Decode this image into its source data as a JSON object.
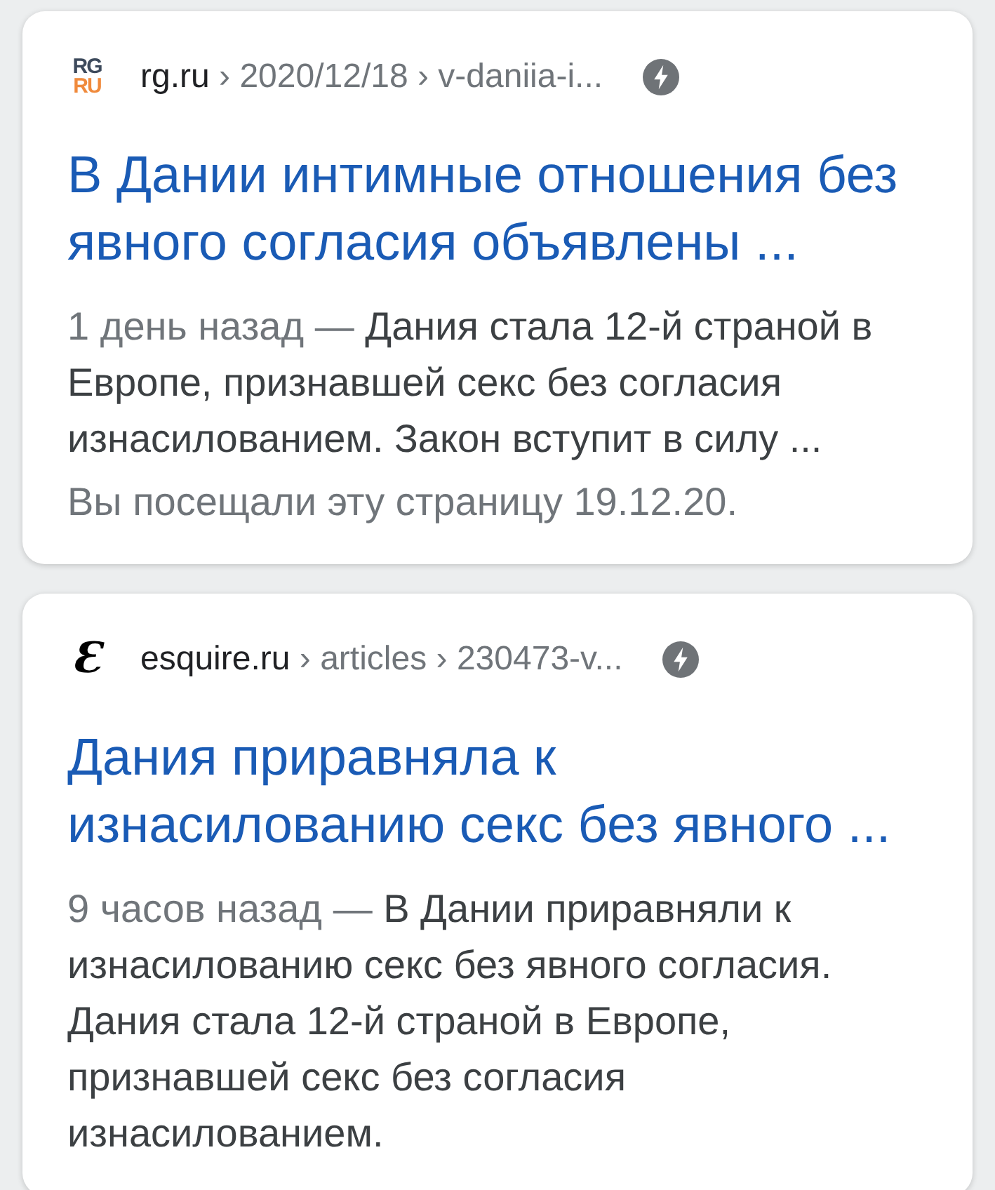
{
  "results": [
    {
      "logo": {
        "kind": "stacked",
        "lines": [
          "RG",
          "RU"
        ]
      },
      "separator": "›",
      "dash": "—",
      "domain": "rg.ru",
      "path": [
        "2020/12/18",
        "v-daniia-i..."
      ],
      "amp": true,
      "title": "В Дании интимные отношения без явного согласия объявлены ...",
      "date": "1 день назад",
      "snippet": "Дания стала 12-й страной в Европе, признавшей секс без согласия изнасилованием. Закон вступит в силу ...",
      "visited": "Вы посещали эту страницу 19.12.20."
    },
    {
      "logo": {
        "kind": "glyph",
        "lines": [
          "Ɛ"
        ]
      },
      "separator": "›",
      "dash": "—",
      "domain": "esquire.ru",
      "path": [
        "articles",
        "230473-v..."
      ],
      "amp": true,
      "title": "Дания приравняла к изнасилованию секс без явного ...",
      "date": "9 часов назад",
      "snippet": "В Дании приравняли к изнасилованию секс без явного согласия. Дания стала 12-й страной в Европе, признавшей секс без согласия изнасилованием."
    }
  ]
}
